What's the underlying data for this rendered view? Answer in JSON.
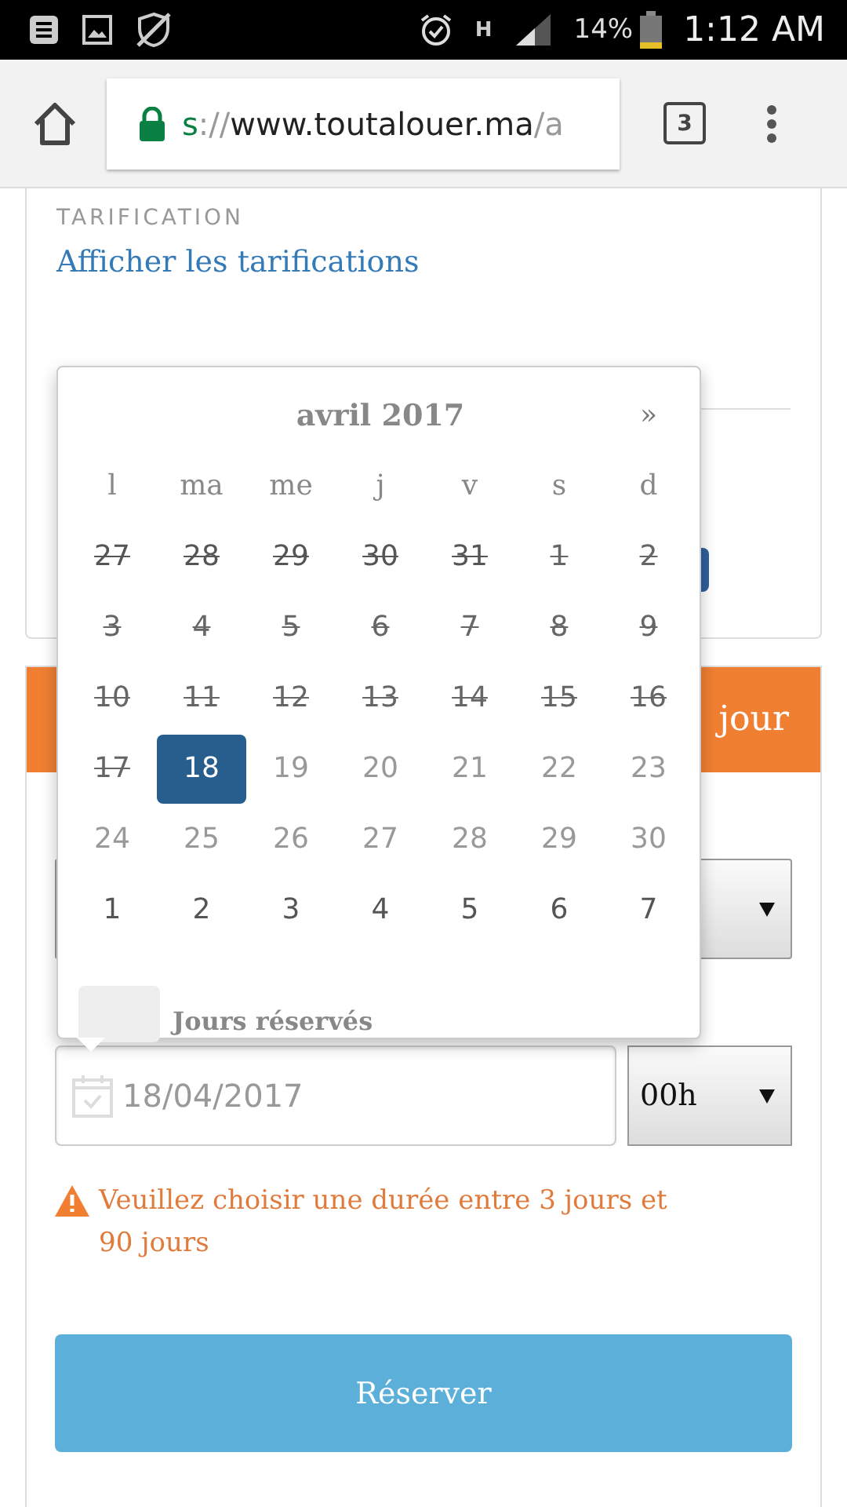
{
  "status_bar": {
    "network": "H",
    "battery": "14%",
    "time": "1:12 AM"
  },
  "browser": {
    "url": [
      {
        "text": "s",
        "color": "#0b8043"
      },
      {
        "text": "://",
        "color": "#999999"
      },
      {
        "text": "www.toutalouer.ma",
        "color": "#222222"
      },
      {
        "text": "/a",
        "color": "#999999"
      }
    ],
    "tab_count": "3"
  },
  "pricing": {
    "label": "TARIFICATION",
    "link": "Afficher les tarifications"
  },
  "booking": {
    "header": "jour",
    "end_date": "18/04/2017",
    "end_hour": "00h",
    "warning": "Veuillez choisir une durée entre 3 jours et 90 jours",
    "submit": "Réserver"
  },
  "datepicker": {
    "title": "avril 2017",
    "next": "»",
    "weekdays": [
      "l",
      "ma",
      "me",
      "j",
      "v",
      "s",
      "d"
    ],
    "weeks": [
      [
        {
          "day": "27",
          "reserved": true,
          "selected": false,
          "other_month": true
        },
        {
          "day": "28",
          "reserved": true,
          "selected": false,
          "other_month": true
        },
        {
          "day": "29",
          "reserved": true,
          "selected": false,
          "other_month": true
        },
        {
          "day": "30",
          "reserved": true,
          "selected": false,
          "other_month": true
        },
        {
          "day": "31",
          "reserved": true,
          "selected": false,
          "other_month": true
        },
        {
          "day": "1",
          "reserved": true,
          "selected": false,
          "other_month": false
        },
        {
          "day": "2",
          "reserved": true,
          "selected": false,
          "other_month": false
        }
      ],
      [
        {
          "day": "3",
          "reserved": true,
          "selected": false,
          "other_month": false
        },
        {
          "day": "4",
          "reserved": true,
          "selected": false,
          "other_month": false
        },
        {
          "day": "5",
          "reserved": true,
          "selected": false,
          "other_month": false
        },
        {
          "day": "6",
          "reserved": true,
          "selected": false,
          "other_month": false
        },
        {
          "day": "7",
          "reserved": true,
          "selected": false,
          "other_month": false
        },
        {
          "day": "8",
          "reserved": true,
          "selected": false,
          "other_month": false
        },
        {
          "day": "9",
          "reserved": true,
          "selected": false,
          "other_month": false
        }
      ],
      [
        {
          "day": "10",
          "reserved": true,
          "selected": false,
          "other_month": false
        },
        {
          "day": "11",
          "reserved": true,
          "selected": false,
          "other_month": false
        },
        {
          "day": "12",
          "reserved": true,
          "selected": false,
          "other_month": false
        },
        {
          "day": "13",
          "reserved": true,
          "selected": false,
          "other_month": false
        },
        {
          "day": "14",
          "reserved": true,
          "selected": false,
          "other_month": false
        },
        {
          "day": "15",
          "reserved": true,
          "selected": false,
          "other_month": false
        },
        {
          "day": "16",
          "reserved": true,
          "selected": false,
          "other_month": false
        }
      ],
      [
        {
          "day": "17",
          "reserved": true,
          "selected": false,
          "other_month": false
        },
        {
          "day": "18",
          "reserved": false,
          "selected": true,
          "other_month": false
        },
        {
          "day": "19",
          "reserved": false,
          "selected": false,
          "other_month": false
        },
        {
          "day": "20",
          "reserved": false,
          "selected": false,
          "other_month": false
        },
        {
          "day": "21",
          "reserved": false,
          "selected": false,
          "other_month": false
        },
        {
          "day": "22",
          "reserved": false,
          "selected": false,
          "other_month": false
        },
        {
          "day": "23",
          "reserved": false,
          "selected": false,
          "other_month": false
        }
      ],
      [
        {
          "day": "24",
          "reserved": false,
          "selected": false,
          "other_month": false
        },
        {
          "day": "25",
          "reserved": false,
          "selected": false,
          "other_month": false
        },
        {
          "day": "26",
          "reserved": false,
          "selected": false,
          "other_month": false
        },
        {
          "day": "27",
          "reserved": false,
          "selected": false,
          "other_month": false
        },
        {
          "day": "28",
          "reserved": false,
          "selected": false,
          "other_month": false
        },
        {
          "day": "29",
          "reserved": false,
          "selected": false,
          "other_month": false
        },
        {
          "day": "30",
          "reserved": false,
          "selected": false,
          "other_month": false
        }
      ],
      [
        {
          "day": "1",
          "reserved": false,
          "selected": false,
          "other_month": true
        },
        {
          "day": "2",
          "reserved": false,
          "selected": false,
          "other_month": true
        },
        {
          "day": "3",
          "reserved": false,
          "selected": false,
          "other_month": true
        },
        {
          "day": "4",
          "reserved": false,
          "selected": false,
          "other_month": true
        },
        {
          "day": "5",
          "reserved": false,
          "selected": false,
          "other_month": true
        },
        {
          "day": "6",
          "reserved": false,
          "selected": false,
          "other_month": true
        },
        {
          "day": "7",
          "reserved": false,
          "selected": false,
          "other_month": true
        }
      ]
    ],
    "legend": "Jours réservés"
  }
}
